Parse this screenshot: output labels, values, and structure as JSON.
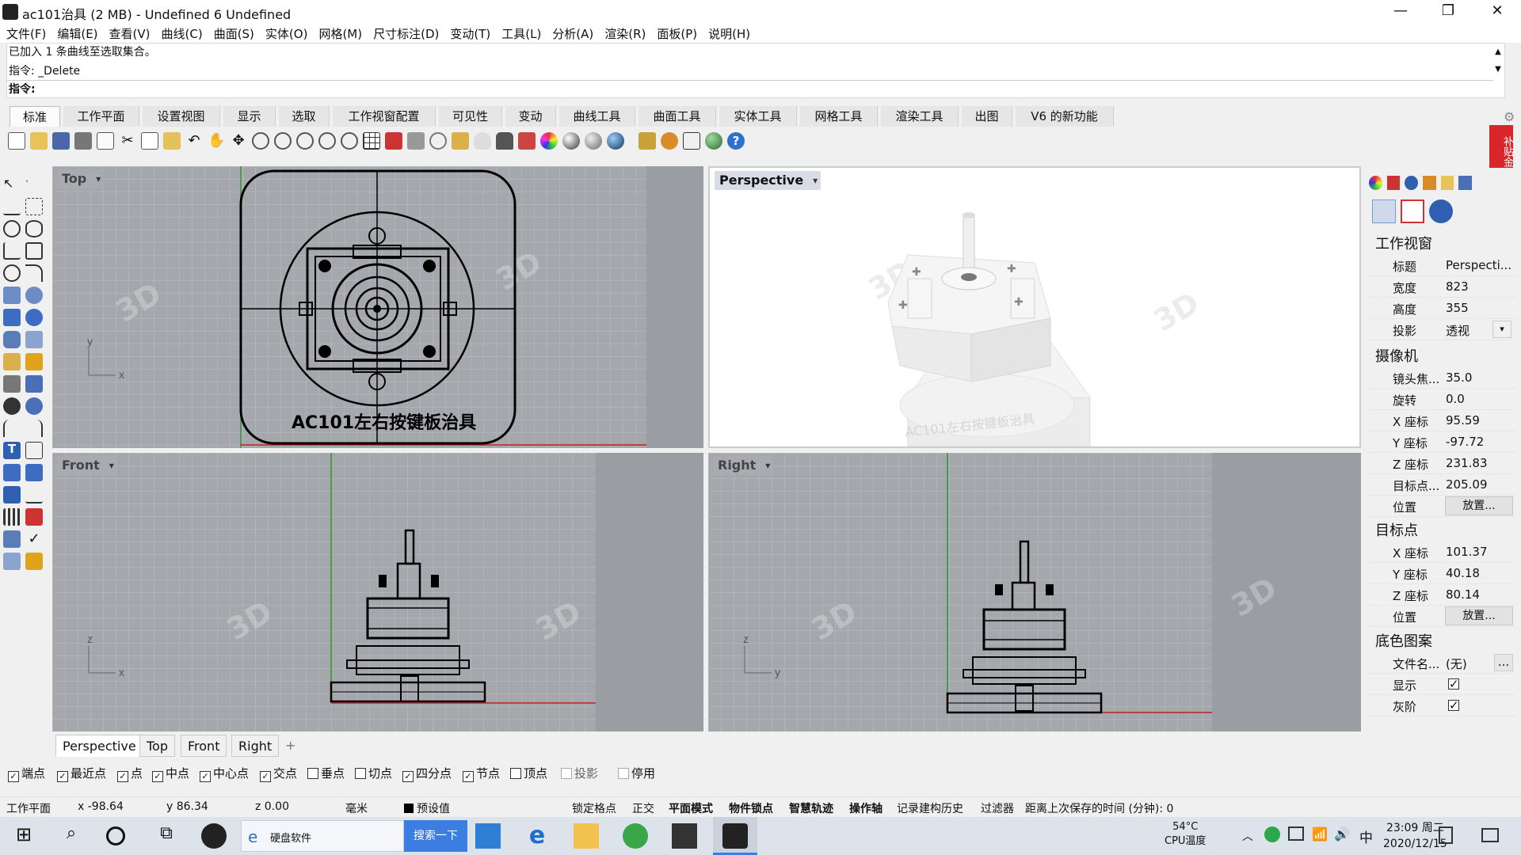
{
  "window": {
    "title": "ac101治具 (2 MB) - Undefined 6 Undefined",
    "minimize": "—",
    "restore": "❐",
    "close": "✕"
  },
  "menu": [
    "文件(F)",
    "编辑(E)",
    "查看(V)",
    "曲线(C)",
    "曲面(S)",
    "实体(O)",
    "网格(M)",
    "尺寸标注(D)",
    "变动(T)",
    "工具(L)",
    "分析(A)",
    "渲染(R)",
    "面板(P)",
    "说明(H)"
  ],
  "command": {
    "history1": "已加入 1 条曲线至选取集合。",
    "history2": "指令: _Delete",
    "prompt": "指令:"
  },
  "tabs": [
    "标准",
    "工作平面",
    "设置视图",
    "显示",
    "选取",
    "工作视窗配置",
    "可见性",
    "变动",
    "曲线工具",
    "曲面工具",
    "实体工具",
    "网格工具",
    "渲染工具",
    "出图",
    "V6 的新功能"
  ],
  "viewports": {
    "top": "Top",
    "perspective": "Perspective",
    "front": "Front",
    "right": "Right"
  },
  "model_label": "AC101左右按键板治具",
  "vp_tabs": [
    "Perspective",
    "Top",
    "Front",
    "Right"
  ],
  "vp_tab_add": "+",
  "osnaps": [
    {
      "label": "端点",
      "checked": true
    },
    {
      "label": "最近点",
      "checked": true
    },
    {
      "label": "点",
      "checked": true
    },
    {
      "label": "中点",
      "checked": true
    },
    {
      "label": "中心点",
      "checked": true
    },
    {
      "label": "交点",
      "checked": true
    },
    {
      "label": "垂点",
      "checked": false
    },
    {
      "label": "切点",
      "checked": false
    },
    {
      "label": "四分点",
      "checked": true
    },
    {
      "label": "节点",
      "checked": true
    },
    {
      "label": "顶点",
      "checked": false
    },
    {
      "label": "投影",
      "checked": false
    },
    {
      "label": "停用",
      "checked": false
    }
  ],
  "status": {
    "cplane": "工作平面",
    "x": "x -98.64",
    "y": "y 86.34",
    "z": "z 0.00",
    "unit": "毫米",
    "layer": "预设值",
    "grid_snap": "锁定格点",
    "ortho": "正交",
    "planar": "平面模式",
    "osnap": "物件锁点",
    "smarttrack": "智慧轨迹",
    "gumball": "操作轴",
    "history": "记录建构历史",
    "filter": "过滤器",
    "save_time": "距离上次保存的时间 (分钟): 0"
  },
  "panel": {
    "viewport_section": "工作视窗",
    "viewport_rows": [
      {
        "k": "标题",
        "v": "Perspecti..."
      },
      {
        "k": "宽度",
        "v": "823"
      },
      {
        "k": "高度",
        "v": "355"
      },
      {
        "k": "投影",
        "v": "透视"
      }
    ],
    "camera_section": "摄像机",
    "camera_rows": [
      {
        "k": "镜头焦...",
        "v": "35.0"
      },
      {
        "k": "旋转",
        "v": "0.0"
      },
      {
        "k": "X 座标",
        "v": "95.59"
      },
      {
        "k": "Y 座标",
        "v": "-97.72"
      },
      {
        "k": "Z 座标",
        "v": "231.83"
      },
      {
        "k": "目标点...",
        "v": "205.09"
      },
      {
        "k": "位置",
        "v": "放置..."
      }
    ],
    "target_section": "目标点",
    "target_rows": [
      {
        "k": "X 座标",
        "v": "101.37"
      },
      {
        "k": "Y 座标",
        "v": "40.18"
      },
      {
        "k": "Z 座标",
        "v": "80.14"
      },
      {
        "k": "位置",
        "v": "放置..."
      }
    ],
    "wallpaper_section": "底色图案",
    "wallpaper_rows": [
      {
        "k": "文件名...",
        "v": "(无)"
      },
      {
        "k": "显示",
        "v": "✓"
      },
      {
        "k": "灰阶",
        "v": "✓"
      }
    ],
    "more": "..."
  },
  "side_badge": "补贴金",
  "taskbar": {
    "search_app": "硬盘软件",
    "search_btn": "搜索一下",
    "temp": "54°C",
    "temp_label": "CPU温度",
    "ime": "中",
    "time": "23:09 周二",
    "date": "2020/12/15"
  }
}
